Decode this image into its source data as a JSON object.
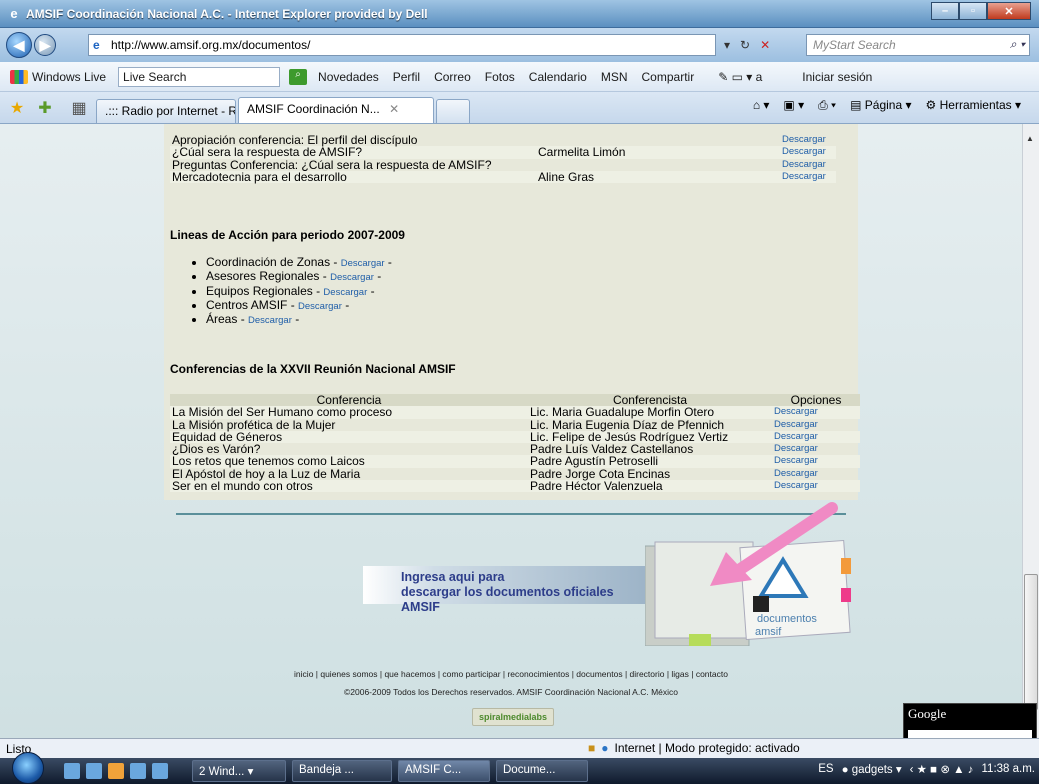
{
  "window": {
    "title": "AMSIF Coordinación Nacional A.C. - Internet Explorer provided by Dell"
  },
  "address": {
    "url": "http://www.amsif.org.mx/documentos/",
    "search_placeholder": "MyStart Search"
  },
  "links_toolbar": {
    "brand": "Windows Live",
    "search_placeholder": "Live Search",
    "links": [
      "Novedades",
      "Perfil",
      "Correo",
      "Fotos",
      "Calendario",
      "MSN",
      "Compartir"
    ],
    "signin": "Iniciar sesión"
  },
  "tabs": [
    {
      "label": ".::: Radio por Internet - Red..."
    },
    {
      "label": "AMSIF Coordinación N..."
    }
  ],
  "tools": {
    "page": "Página",
    "tools": "Herramientas"
  },
  "top_table": {
    "rows": [
      {
        "title": "Apropiación conferencia: El perfil del discípulo",
        "speaker": "",
        "option": "Descargar"
      },
      {
        "title": "¿Cúal sera la respuesta de AMSIF?",
        "speaker": "Carmelita Limón",
        "option": "Descargar"
      },
      {
        "title": "Preguntas Conferencia: ¿Cúal sera la respuesta de AMSIF?",
        "speaker": "",
        "option": "Descargar"
      },
      {
        "title": "Mercadotecnia para el desarrollo",
        "speaker": "Aline Gras",
        "option": "Descargar"
      }
    ]
  },
  "lineas": {
    "title": "Lineas de Acción para periodo 2007-2009",
    "items": [
      {
        "label": "Coordinación de Zonas",
        "link": "Descargar"
      },
      {
        "label": "Asesores Regionales",
        "link": "Descargar"
      },
      {
        "label": "Equipos Regionales",
        "link": "Descargar"
      },
      {
        "label": "Centros AMSIF",
        "link": "Descargar"
      },
      {
        "label": "Áreas",
        "link": "Descargar"
      }
    ]
  },
  "conferencias": {
    "title": "Conferencias de la XXVII Reunión Nacional AMSIF",
    "headers": [
      "Conferencia",
      "Conferencista",
      "Opciones"
    ],
    "rows": [
      {
        "title": "La Misión del Ser Humano como proceso",
        "speaker": "Lic. Maria Guadalupe Morfin Otero",
        "option": "Descargar"
      },
      {
        "title": "La Misión profética de la Mujer",
        "speaker": "Lic. Maria Eugenia Díaz de Pfennich",
        "option": "Descargar"
      },
      {
        "title": "Equidad de Géneros",
        "speaker": "Lic. Felipe de Jesús Rodríguez Vertiz",
        "option": "Descargar"
      },
      {
        "title": "¿Dios es Varón?",
        "speaker": "Padre Luís Valdez Castellanos",
        "option": "Descargar"
      },
      {
        "title": "Los retos que tenemos como Laicos",
        "speaker": "Padre Agustín Petroselli",
        "option": "Descargar"
      },
      {
        "title": "El Apóstol de hoy a la Luz de Maria",
        "speaker": "Padre Jorge Cota Encinas",
        "option": "Descargar"
      },
      {
        "title": "Ser en el mundo con otros",
        "speaker": "Padre Héctor Valenzuela",
        "option": "Descargar"
      }
    ]
  },
  "banner": {
    "line1": "Ingresa aqui para",
    "line2": "descargar los documentos oficiales AMSIF",
    "folder_label1": "documentos",
    "folder_label2": "amsif"
  },
  "footer": {
    "nav": "inicio | quienes somos | que hacemos | como participar | reconocimientos | documentos | directorio | ligas | contacto",
    "copyright": "©2006-2009 Todos los Derechos reservados. AMSIF Coordinación Nacional A.C. México",
    "credit": "spiralmedialabs"
  },
  "google_widget": {
    "label": "Google"
  },
  "status": {
    "text": "Listo",
    "zone": "Internet | Modo protegido: activado"
  },
  "taskbar": {
    "buttons": [
      "2 Wind...",
      "Bandeja ...",
      "AMSIF C...",
      "Docume..."
    ],
    "lang": "ES",
    "gadgets": "gadgets",
    "clock": "11:38 a.m."
  }
}
